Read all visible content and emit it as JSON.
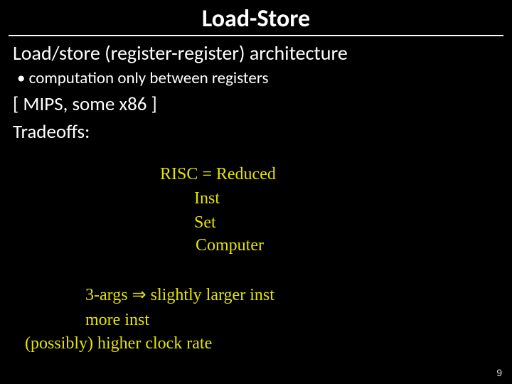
{
  "title": "Load-Store",
  "subtitle": "Load/store (register-register) architecture",
  "bullet1": "computation only between registers",
  "examples": "[ MIPS, some x86 ]",
  "tradeoffs_label": "Tradeoffs:",
  "hand": {
    "risc1": "RISC = Reduced",
    "risc2": "Inst",
    "risc3": "Set",
    "risc4": "Computer",
    "t1": "3-args ⇒ slightly larger inst",
    "t2": "more inst",
    "t3": "(possibly)  higher clock rate"
  },
  "page_number": "9"
}
